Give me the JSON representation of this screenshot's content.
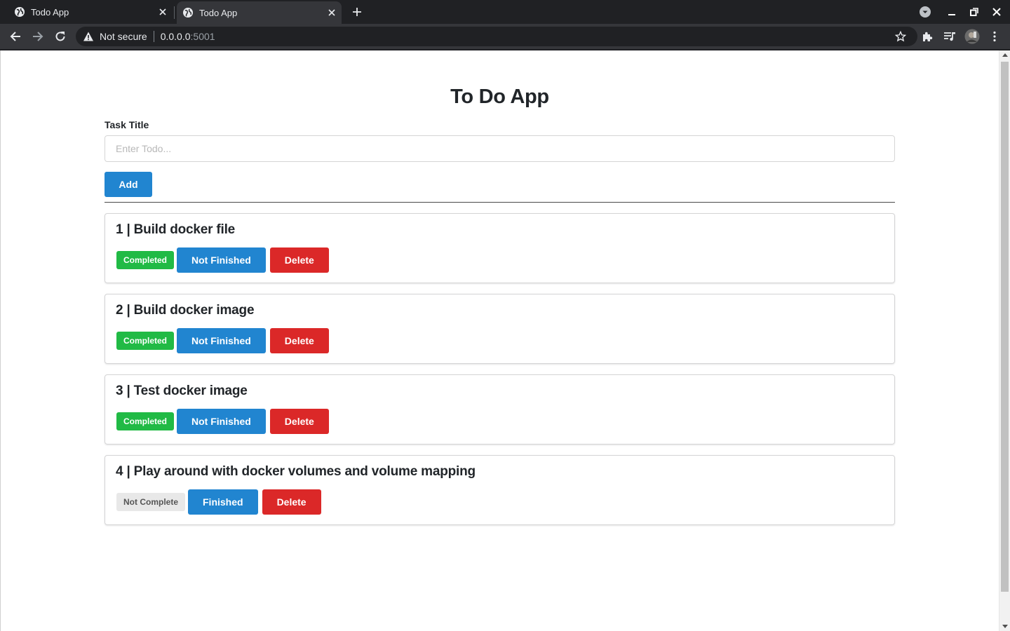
{
  "browser": {
    "tabs": [
      {
        "title": "Todo App",
        "active": false
      },
      {
        "title": "Todo App",
        "active": true
      }
    ],
    "address": {
      "security_label": "Not secure",
      "host": "0.0.0.0",
      "port": ":5001"
    },
    "icons": {
      "back": "arrow-left-icon",
      "forward": "arrow-right-icon",
      "reload": "reload-icon",
      "warning": "warning-triangle-icon",
      "star": "star-icon",
      "extensions": "puzzle-icon",
      "media": "queue-music-icon",
      "profile": "avatar",
      "menu": "kebab-menu-icon"
    }
  },
  "app": {
    "title": "To Do App",
    "form": {
      "label": "Task Title",
      "placeholder": "Enter Todo...",
      "value": "",
      "add_label": "Add"
    },
    "tasks": [
      {
        "title": "1 | Build docker file",
        "status": "Completed",
        "complete": true,
        "toggle_label": "Not Finished",
        "delete_label": "Delete"
      },
      {
        "title": "2 | Build docker image",
        "status": "Completed",
        "complete": true,
        "toggle_label": "Not Finished",
        "delete_label": "Delete"
      },
      {
        "title": "3 | Test docker image",
        "status": "Completed",
        "complete": true,
        "toggle_label": "Not Finished",
        "delete_label": "Delete"
      },
      {
        "title": "4 | Play around with docker volumes and volume mapping",
        "status": "Not Complete",
        "complete": false,
        "toggle_label": "Finished",
        "delete_label": "Delete"
      }
    ]
  },
  "colors": {
    "primary": "#2185d0",
    "success": "#21ba45",
    "danger": "#db2828",
    "neutral_badge": "#e8e8e8"
  }
}
